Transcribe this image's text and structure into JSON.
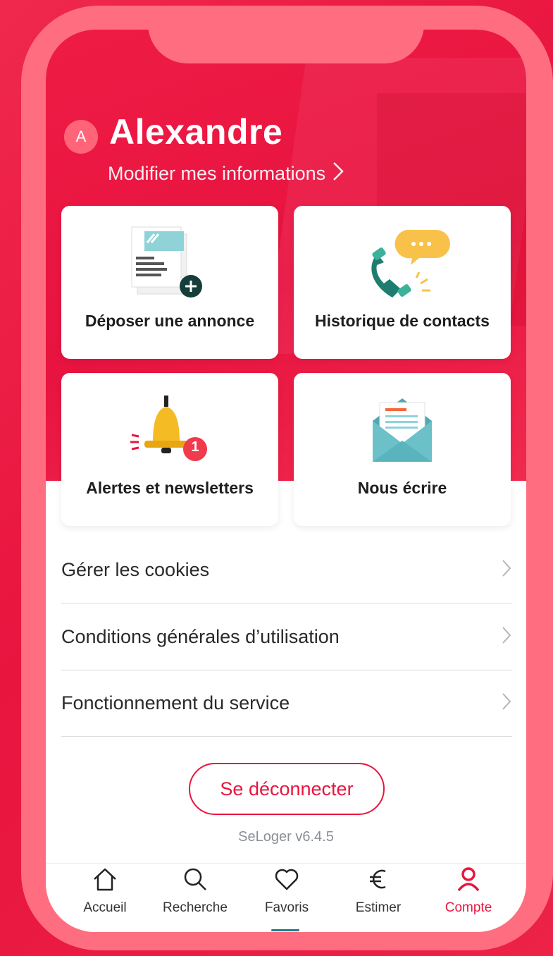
{
  "profile": {
    "initial": "A",
    "name": "Alexandre",
    "edit_link": "Modifier mes informations"
  },
  "tiles": [
    {
      "label": "Déposer une annonce",
      "icon": "newspaper-add-icon"
    },
    {
      "label": "Historique de contacts",
      "icon": "phone-chat-icon"
    },
    {
      "label": "Alertes et newsletters",
      "icon": "bell-icon",
      "badge": "1"
    },
    {
      "label": "Nous écrire",
      "icon": "envelope-icon"
    }
  ],
  "menu": [
    {
      "label": "Gérer les cookies"
    },
    {
      "label": "Conditions générales d’utilisation"
    },
    {
      "label": "Fonctionnement du service"
    }
  ],
  "logout_label": "Se déconnecter",
  "version": "SeLoger v6.4.5",
  "tabs": [
    {
      "label": "Accueil",
      "icon": "home-icon"
    },
    {
      "label": "Recherche",
      "icon": "search-icon"
    },
    {
      "label": "Favoris",
      "icon": "heart-icon"
    },
    {
      "label": "Estimer",
      "icon": "euro-icon"
    },
    {
      "label": "Compte",
      "icon": "user-icon",
      "active": true
    }
  ],
  "colors": {
    "brand": "#e8153f",
    "frame": "#ff6e80",
    "tab_indicator": "#1a7f8a"
  }
}
